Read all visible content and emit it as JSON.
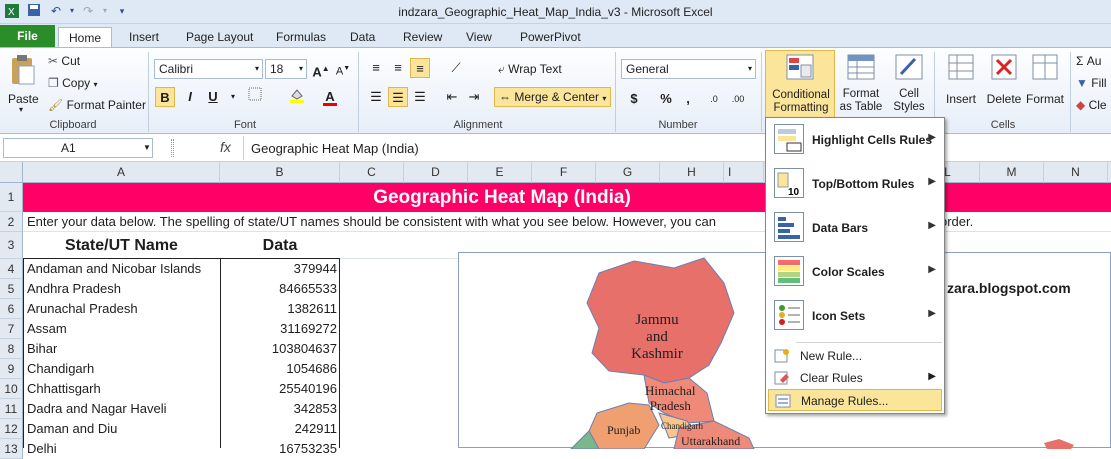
{
  "window": {
    "title": "indzara_Geographic_Heat_Map_India_v3  -  Microsoft Excel"
  },
  "tabs": [
    "File",
    "Home",
    "Insert",
    "Page Layout",
    "Formulas",
    "Data",
    "Review",
    "View",
    "PowerPivot"
  ],
  "ribbon": {
    "clipboard": {
      "paste": "Paste",
      "cut": "Cut",
      "copy": "Copy",
      "format_painter": "Format Painter",
      "label": "Clipboard"
    },
    "font": {
      "name": "Calibri",
      "size": "18",
      "bold": "B",
      "italic": "I",
      "underline": "U",
      "label": "Font"
    },
    "alignment": {
      "wrap": "Wrap Text",
      "merge": "Merge & Center",
      "label": "Alignment"
    },
    "number": {
      "format": "General",
      "currency": "$",
      "percent": "%",
      "comma": ",",
      "label": "Number"
    },
    "styles": {
      "conditional_formatting": "Conditional Formatting",
      "format_as_table": "Format as Table",
      "cell_styles": "Cell Styles"
    },
    "cells": {
      "insert": "Insert",
      "delete": "Delete",
      "format": "Format",
      "label": "Cells"
    },
    "editing": {
      "autosum": "Au",
      "fill": "Fill",
      "clear": "Cle"
    }
  },
  "formula_bar": {
    "name_box": "A1",
    "fx": "fx",
    "formula": "Geographic Heat Map (India)"
  },
  "columns": [
    "A",
    "B",
    "C",
    "D",
    "E",
    "F",
    "G",
    "H",
    "I",
    "J",
    "K",
    "L",
    "M",
    "N"
  ],
  "rows": [
    "1",
    "2",
    "3",
    "4",
    "5",
    "6",
    "7",
    "8",
    "9",
    "10",
    "11",
    "12",
    "13"
  ],
  "sheet": {
    "title": "Geographic Heat Map (India)",
    "instruction": "Enter your data below. The spelling of state/UT names should be consistent with what you see below. However, you can",
    "instruction_tail": "order.",
    "header_state": "State/UT Name",
    "header_data": "Data",
    "data": [
      [
        "Andaman and Nicobar Islands",
        "379944"
      ],
      [
        "Andhra Pradesh",
        "84665533"
      ],
      [
        "Arunachal Pradesh",
        "1382611"
      ],
      [
        "Assam",
        "31169272"
      ],
      [
        "Bihar",
        "103804637"
      ],
      [
        "Chandigarh",
        "1054686"
      ],
      [
        "Chhattisgarh",
        "25540196"
      ],
      [
        "Dadra and Nagar Haveli",
        "342853"
      ],
      [
        "Daman and Diu",
        "242911"
      ],
      [
        "Delhi",
        "16753235"
      ]
    ],
    "blog": "zara.blogspot.com"
  },
  "map": {
    "jk": [
      "Jammu",
      "and",
      "Kashmir"
    ],
    "hp": [
      "Himachal",
      "Pradesh"
    ],
    "punjab": "Punjab",
    "chandigarh": "Chandigarh",
    "uttarakhand": "Uttarakhand"
  },
  "cf_menu": {
    "items": [
      "Highlight Cells Rules",
      "Top/Bottom Rules",
      "Data Bars",
      "Color Scales",
      "Icon Sets"
    ],
    "new_rule": "New Rule...",
    "clear_rules": "Clear Rules",
    "manage_rules": "Manage Rules...",
    "topbottom_icon_text": "10"
  },
  "colors": {
    "title_bg": "#ff0066",
    "file_tab": "#2a8d2a",
    "highlight": "#fbe59a"
  }
}
